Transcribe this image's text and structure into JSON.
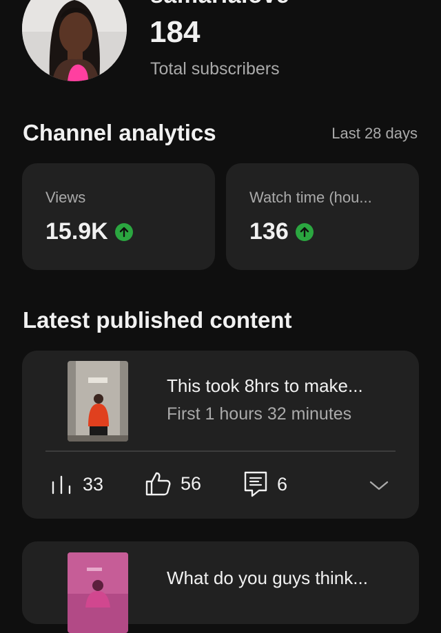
{
  "header": {
    "channel_name": "samarialove",
    "subscriber_count": "184",
    "subscriber_label": "Total subscribers"
  },
  "analytics": {
    "title": "Channel analytics",
    "range": "Last 28 days",
    "stats": [
      {
        "label": "Views",
        "value": "15.9K",
        "trend": "up"
      },
      {
        "label": "Watch time (hou...",
        "value": "136",
        "trend": "up"
      }
    ]
  },
  "latest": {
    "title": "Latest published content",
    "videos": [
      {
        "title": "This took 8hrs to make...",
        "subtitle": "First 1 hours 32 minutes",
        "views": "33",
        "likes": "56",
        "comments": "6"
      },
      {
        "title": "What do you guys think..."
      }
    ]
  },
  "colors": {
    "background": "#0f0f0f",
    "card": "#212121",
    "trend_up": "#2ba640",
    "secondary_text": "#aaaaaa"
  },
  "icons": [
    "arrow-up-icon",
    "views-bars-icon",
    "thumbs-up-icon",
    "comment-icon",
    "chevron-down-icon"
  ]
}
